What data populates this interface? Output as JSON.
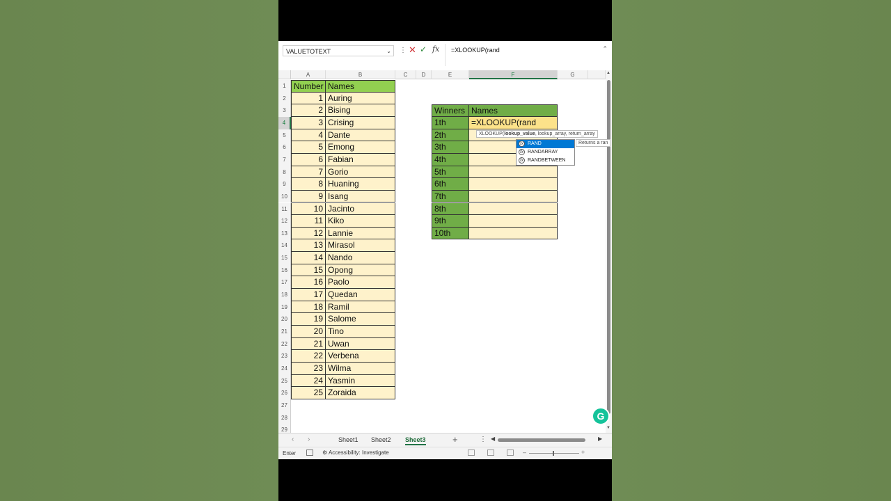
{
  "formula_bar": {
    "name_box": "VALUETOTEXT",
    "formula": "=XLOOKUP(rand",
    "fx_label": "fx"
  },
  "columns": [
    "A",
    "B",
    "C",
    "D",
    "E",
    "F",
    "G"
  ],
  "rows": [
    "1",
    "2",
    "3",
    "4",
    "5",
    "6",
    "7",
    "8",
    "9",
    "10",
    "11",
    "12",
    "13",
    "14",
    "15",
    "16",
    "17",
    "18",
    "19",
    "20",
    "21",
    "22",
    "23",
    "24",
    "25",
    "26",
    "27",
    "28",
    "29"
  ],
  "active_cell": {
    "column": "F",
    "row": "4"
  },
  "names_table": {
    "header_number": "Number",
    "header_names": "Names",
    "rows": [
      [
        "1",
        "Auring"
      ],
      [
        "2",
        "Bising"
      ],
      [
        "3",
        "Crising"
      ],
      [
        "4",
        "Dante"
      ],
      [
        "5",
        "Emong"
      ],
      [
        "6",
        "Fabian"
      ],
      [
        "7",
        "Gorio"
      ],
      [
        "8",
        "Huaning"
      ],
      [
        "9",
        "Isang"
      ],
      [
        "10",
        "Jacinto"
      ],
      [
        "11",
        "Kiko"
      ],
      [
        "12",
        "Lannie"
      ],
      [
        "13",
        "Mirasol"
      ],
      [
        "14",
        "Nando"
      ],
      [
        "15",
        "Opong"
      ],
      [
        "16",
        "Paolo"
      ],
      [
        "17",
        "Quedan"
      ],
      [
        "18",
        "Ramil"
      ],
      [
        "19",
        "Salome"
      ],
      [
        "20",
        "Tino"
      ],
      [
        "21",
        "Uwan"
      ],
      [
        "22",
        "Verbena"
      ],
      [
        "23",
        "Wilma"
      ],
      [
        "24",
        "Yasmin"
      ],
      [
        "25",
        "Zoraida"
      ]
    ]
  },
  "winners_table": {
    "header_winners": "Winners",
    "header_names": "Names",
    "rows": [
      "1th",
      "2th",
      "3th",
      "4th",
      "5th",
      "6th",
      "7th",
      "8th",
      "9th",
      "10th"
    ],
    "editing_text": "=XLOOKUP(rand"
  },
  "autocomplete": {
    "tooltip": "XLOOKUP(lookup_value, lookup_array, return_array",
    "tooltip_bold": "lookup_value",
    "items": [
      "RAND",
      "RANDARRAY",
      "RANDBETWEEN"
    ],
    "selected_index": 0,
    "description": "Returns a ran"
  },
  "sheet_tabs": [
    "Sheet1",
    "Sheet2",
    "Sheet3"
  ],
  "active_sheet": "Sheet3",
  "status_bar": {
    "mode": "Enter",
    "accessibility": "Accessibility: Investigate"
  },
  "colors": {
    "header_green": "#92d050",
    "cream": "#fef2cb",
    "winners_green": "#70ad47",
    "excel_green": "#217346"
  }
}
